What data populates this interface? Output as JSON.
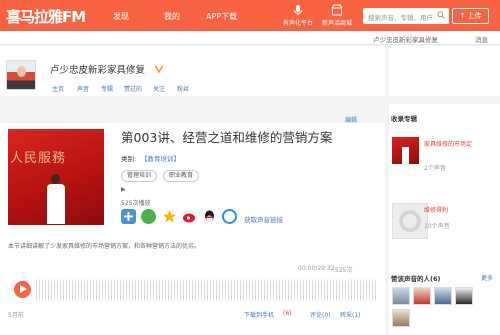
{
  "colors": {
    "brand": "#f86442",
    "link": "#4a7ab6",
    "accent_red": "#e0453a"
  },
  "header": {
    "logo": "喜马拉雅FM",
    "nav": [
      "发现",
      "我的",
      "APP下载"
    ],
    "buttons": [
      {
        "label": "有声化平台",
        "icon": "microphone-icon"
      },
      {
        "label": "新声活商城",
        "icon": "store-icon"
      }
    ],
    "search_placeholder": "搜索声音、专辑、用户",
    "upload_label": "上传"
  },
  "subbar": {
    "user": "卢少忠皮新彩家具修复",
    "messages": "消息"
  },
  "profile": {
    "name": "卢少忠皮新彩家具修复",
    "tabs": [
      "主页",
      "声音",
      "专辑",
      "赞过的",
      "关注",
      "粉丝"
    ]
  },
  "track": {
    "edit_label": "编辑",
    "cover_text": "人民服務",
    "title": "第003讲、经营之道和维修的营销方案",
    "category_label": "类别:",
    "category": "【教育培训】",
    "tags": [
      "管理培训",
      "职业教育"
    ],
    "plays": "525次播放",
    "share_link": "获取声音链接",
    "description": "本节讲细讲解了少发家具维修的市场营销方案，和各种营销方法的优劣。",
    "time": "00:00/29:32",
    "play_count": "525次",
    "date": "5月前",
    "actions": [
      "下载到手机",
      "(6)",
      "评论(0)",
      "转采(1)"
    ]
  },
  "sidebar": {
    "album_title": "收录专辑",
    "albums": [
      {
        "name": "家具维修的市场定",
        "count": "2个声音"
      },
      {
        "name": "维修得利",
        "count": "10个声音"
      }
    ],
    "liked_title": "赞该声音的人(6)",
    "liked_more": "更多"
  }
}
